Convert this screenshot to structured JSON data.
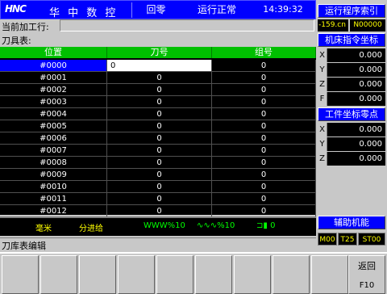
{
  "header": {
    "logo": "HNC",
    "brand": "华 中 数 控",
    "mode": "回零",
    "status": "运行正常",
    "clock": "14:39:32"
  },
  "current_row": {
    "label": "当前加工行:",
    "value": ""
  },
  "table_label": "刀具表:",
  "table": {
    "columns": [
      "位置",
      "刀号",
      "组号"
    ],
    "rows": [
      [
        "#0000",
        "0",
        "0"
      ],
      [
        "#0001",
        "0",
        "0"
      ],
      [
        "#0002",
        "0",
        "0"
      ],
      [
        "#0003",
        "0",
        "0"
      ],
      [
        "#0004",
        "0",
        "0"
      ],
      [
        "#0005",
        "0",
        "0"
      ],
      [
        "#0006",
        "0",
        "0"
      ],
      [
        "#0007",
        "0",
        "0"
      ],
      [
        "#0008",
        "0",
        "0"
      ],
      [
        "#0009",
        "0",
        "0"
      ],
      [
        "#0010",
        "0",
        "0"
      ],
      [
        "#0011",
        "0",
        "0"
      ],
      [
        "#0012",
        "0",
        "0"
      ]
    ]
  },
  "feed_strip": {
    "unit": "毫米",
    "feed_mode": "分进给",
    "feed_override": "WWW%10",
    "rapid_override": "∿∿∿%10",
    "spindle_override": "0"
  },
  "screen_title": "刀库表编辑",
  "right_panel": {
    "prog_index_title": "运行程序索引",
    "prog_line": "-159.cn",
    "prog_no": "N00000",
    "machine_coord_title": "机床指令坐标",
    "machine_coords": [
      {
        "axis": "X",
        "value": "0.000"
      },
      {
        "axis": "Y",
        "value": "0.000"
      },
      {
        "axis": "Z",
        "value": "0.000"
      },
      {
        "axis": "F",
        "value": "0.000"
      }
    ],
    "work_zero_title": "工件坐标零点",
    "work_coords": [
      {
        "axis": "X",
        "value": "0.000"
      },
      {
        "axis": "Y",
        "value": "0.000"
      },
      {
        "axis": "Z",
        "value": "0.000"
      }
    ],
    "aux_title": "辅助机能",
    "m": "M00",
    "t": "T25",
    "s": "ST00"
  },
  "fkeys": [
    {
      "label": "",
      "num": ""
    },
    {
      "label": "",
      "num": ""
    },
    {
      "label": "",
      "num": ""
    },
    {
      "label": "",
      "num": ""
    },
    {
      "label": "",
      "num": ""
    },
    {
      "label": "",
      "num": ""
    },
    {
      "label": "",
      "num": ""
    },
    {
      "label": "",
      "num": ""
    },
    {
      "label": "",
      "num": ""
    },
    {
      "label": "返回",
      "num": "F10"
    }
  ],
  "colors": {
    "header_bg": "#0000ff",
    "table_header_bg": "#00c000",
    "table_bg": "#000000",
    "selected_cell": "#0000ff",
    "status_text": "#ffff00"
  }
}
